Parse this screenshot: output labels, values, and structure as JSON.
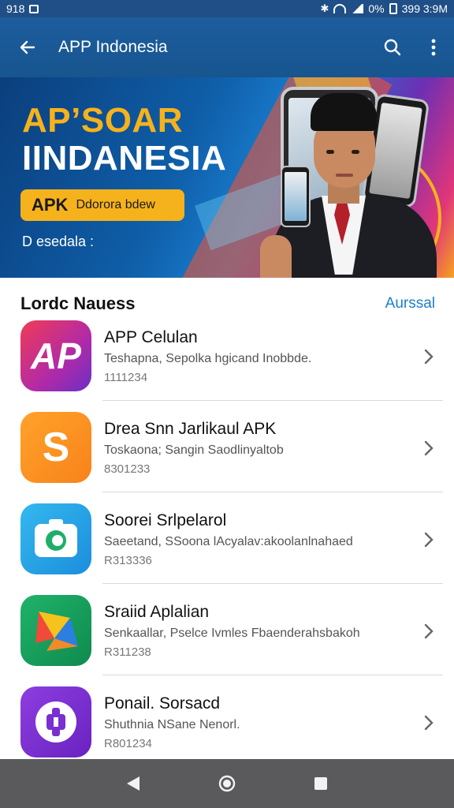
{
  "status_bar": {
    "time": "918",
    "right_text": "0%",
    "clock": "399 3:9M"
  },
  "app_bar": {
    "title": "APP Indonesia"
  },
  "banner": {
    "title_line1": "AP’SOAR",
    "title_line2": "IINDANESIA",
    "pill_apk": "APK",
    "pill_text": "Ddorora bdew",
    "desc": "D esedala :"
  },
  "section": {
    "title": "Lordc Nauess",
    "link": "Aurssal"
  },
  "apps": [
    {
      "name": "APP Celulan",
      "desc": "Teshapna, Sepolka hgicand Inobbde.",
      "meta": "1111234",
      "icon": "ap-logo-icon",
      "icon_text": "AP"
    },
    {
      "name": "Drea Snn Jarlikaul APK",
      "desc": "Toskaona; Sangin Saodlinyaltob",
      "meta": "8301233",
      "icon": "letter-s-logo-icon",
      "icon_text": "S"
    },
    {
      "name": "Soorei Srlpelarol",
      "desc": "Saeetand, SSoona lAcyalav:akoolanlnahaed",
      "meta": "R313336",
      "icon": "camera-logo-icon",
      "icon_text": ""
    },
    {
      "name": "Sraiid Aplalian",
      "desc": "Senkaallar, Pselce Ivmles Fbaenderahsbakoh",
      "meta": "R311238",
      "icon": "triangle-logo-icon",
      "icon_text": ""
    },
    {
      "name": "Ponail. Sorsacd",
      "desc": "Shuthnia NSane Nenorl.",
      "meta": "R801234",
      "icon": "puzzle-logo-icon",
      "icon_text": ""
    }
  ]
}
